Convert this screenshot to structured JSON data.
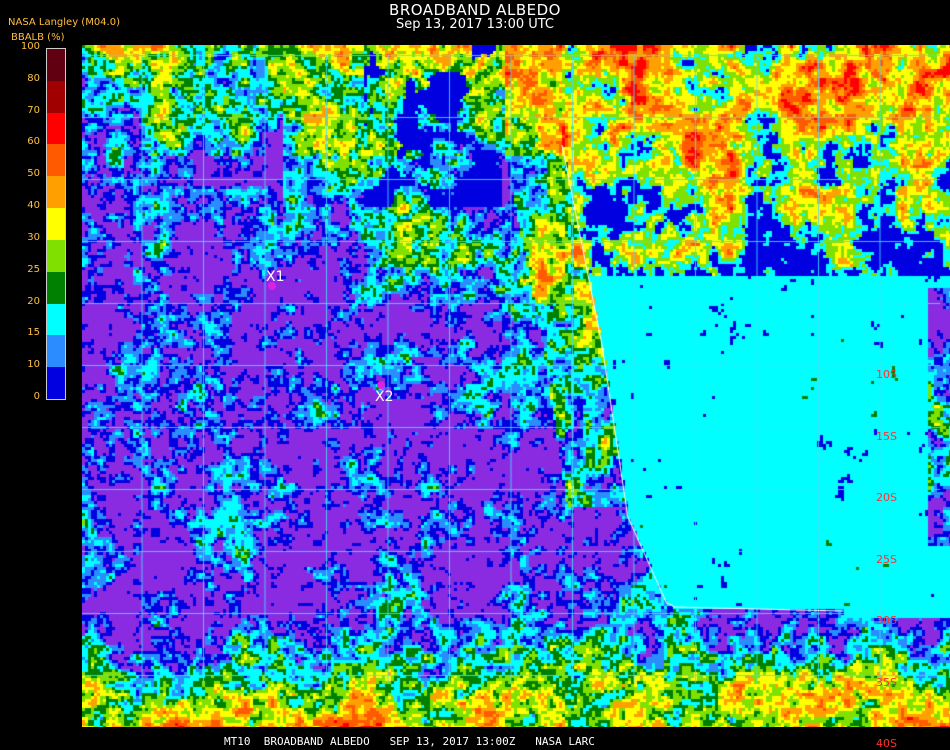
{
  "header": {
    "title": "BROADBAND ALBEDO",
    "subtitle": "Sep 13, 2017 13:00 UTC",
    "source": "NASA Langley (M04.0)",
    "unit": "BBALB (%)"
  },
  "colorbar": {
    "ticks": [
      "100",
      "80",
      "70",
      "60",
      "50",
      "40",
      "30",
      "25",
      "20",
      "15",
      "10",
      "0"
    ],
    "colors": [
      "#600010",
      "#a00000",
      "#ff0000",
      "#ff5a00",
      "#ffa000",
      "#ffff00",
      "#80e000",
      "#008000",
      "#00ffff",
      "#2a8cff",
      "#0000e0",
      "#8a2be2"
    ]
  },
  "map": {
    "lat_labels": [
      "10S",
      "15S",
      "20S",
      "25S",
      "30S",
      "35S",
      "40S"
    ],
    "markers": [
      {
        "label": "X1"
      },
      {
        "label": "X2"
      }
    ],
    "colors": {
      "ocean_clear": "#8a2be2",
      "land": "#00ffff",
      "grid": "#40e0ff",
      "coast": "#ffffff"
    }
  },
  "footer": "MT10  BROADBAND ALBEDO   SEP 13, 2017 13:00Z   NASA LARC"
}
